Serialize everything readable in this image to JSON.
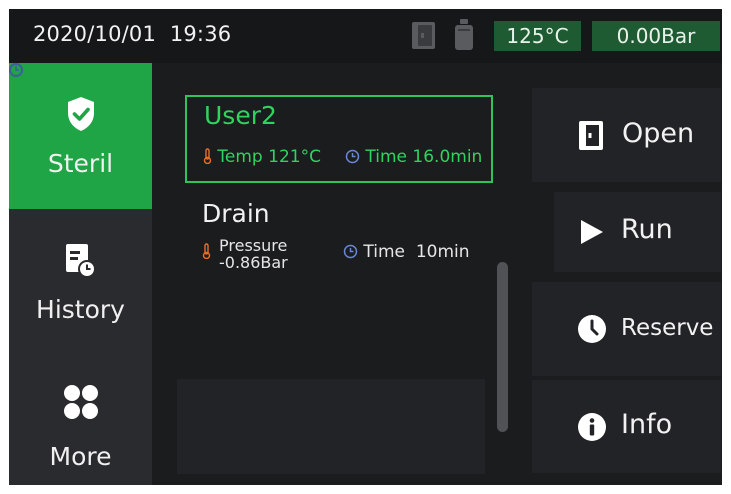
{
  "status_bar": {
    "date": "2020/10/01",
    "time": "19:36",
    "temperature": "125°C",
    "pressure": "0.00Bar",
    "icons": [
      "door-status-icon",
      "water-bottle-icon"
    ]
  },
  "sidebar": {
    "items": [
      {
        "label": "Steril",
        "icon": "shield-check-icon",
        "active": true
      },
      {
        "label": "History",
        "icon": "history-document-icon",
        "active": false
      },
      {
        "label": "More",
        "icon": "grid-dots-icon",
        "active": false
      }
    ]
  },
  "programs": [
    {
      "name": "User2",
      "selected": true,
      "param_label": "Temp",
      "param_value": "121°C",
      "time_label": "Time",
      "time_value": "16.0min"
    },
    {
      "name": "Drain",
      "selected": false,
      "param_label": "Pressure",
      "param_value": "-0.86Bar",
      "time_label": "Time",
      "time_value": "10min"
    }
  ],
  "actions": [
    {
      "label": "Open",
      "icon": "door-open-icon"
    },
    {
      "label": "Run",
      "icon": "play-icon"
    },
    {
      "label": "Reserve",
      "icon": "clock-icon"
    },
    {
      "label": "Info",
      "icon": "info-icon"
    }
  ],
  "colors": {
    "accent_green": "#20a546",
    "selected_text": "#2fd35f",
    "temp_orange": "#e8702a",
    "clock_blue": "#6a86d8",
    "badge_green": "#1e5b32"
  }
}
